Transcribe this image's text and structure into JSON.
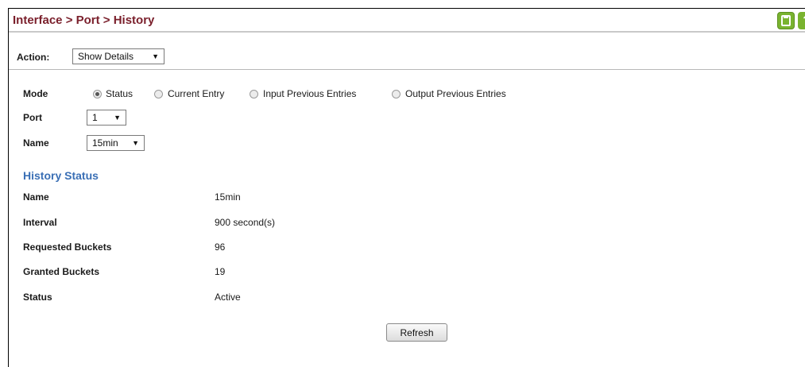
{
  "breadcrumb": "Interface > Port > History",
  "icons": {
    "save": "save-icon",
    "help": "help-icon"
  },
  "colors": {
    "breadcrumb": "#7a1f2b",
    "section_title": "#3a6fb5",
    "icon_green": "#79b32f"
  },
  "action": {
    "label": "Action:",
    "value": "Show Details"
  },
  "mode": {
    "label": "Mode",
    "options": [
      "Status",
      "Current Entry",
      "Input Previous Entries",
      "Output Previous Entries"
    ],
    "selected": "Status"
  },
  "port": {
    "label": "Port",
    "value": "1"
  },
  "name_select": {
    "label": "Name",
    "value": "15min"
  },
  "history_status": {
    "title": "History Status",
    "rows": [
      {
        "label": "Name",
        "value": "15min"
      },
      {
        "label": "Interval",
        "value": "900 second(s)"
      },
      {
        "label": "Requested Buckets",
        "value": "96"
      },
      {
        "label": "Granted Buckets",
        "value": "19"
      },
      {
        "label": "Status",
        "value": "Active"
      }
    ]
  },
  "refresh_label": "Refresh"
}
